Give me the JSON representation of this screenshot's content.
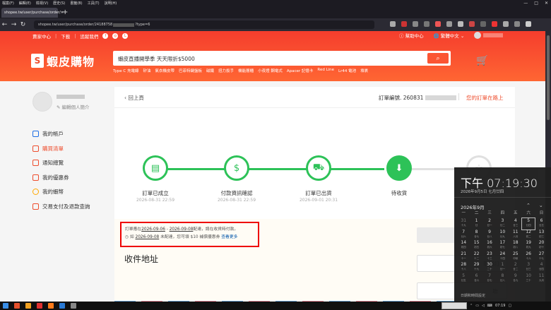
{
  "browser": {
    "menu": [
      "檔案(F)",
      "編輯(E)",
      "檢視(V)",
      "歷史(S)",
      "書籤(B)",
      "工具(T)",
      "說明(H)"
    ],
    "tab_title": "shopee.tw/user/purchase/order/",
    "url_prefix": "shopee.tw/user/purchase/order/24188758",
    "url_suffix": "?type=6"
  },
  "header": {
    "topnav": [
      "賣家中心",
      "下載",
      "追蹤我們"
    ],
    "help": "幫助中心",
    "language": "繁體中文",
    "brand_name": "蝦皮購物",
    "search_placeholder": "蝦皮直播開學季 天天限折$5000",
    "hot_keywords": [
      "Type C 充電線",
      "矽油",
      "氣衣機皮帶",
      "巴菲特鍵盤板",
      "磁鐵",
      "扭力扳手",
      "機能層櫃",
      "小夜燈 鋼電式",
      "Apacer 記憶卡",
      "Red Line",
      "Lr44 電池",
      "墳裹"
    ]
  },
  "sidebar": {
    "edit_profile": "編輯個人簡介",
    "items": [
      {
        "label": "我的帳戶",
        "color": "#1d6ee5"
      },
      {
        "label": "購買清單",
        "color": "#ee4d2d"
      },
      {
        "label": "通知總覽",
        "color": "#ee4d2d"
      },
      {
        "label": "我的優惠券",
        "color": "#ee4d2d"
      },
      {
        "label": "我的蝦幣",
        "color": "#ffa800"
      },
      {
        "label": "交易支付及退款查詢",
        "color": "#ee4d2d"
      }
    ]
  },
  "order": {
    "back_label": "回上頁",
    "order_no_label": "訂單編號. 260831",
    "status_label": "您的訂單在路上",
    "steps": [
      {
        "label": "訂單已成立",
        "time": "2026-08-31 22:59"
      },
      {
        "label": "付款資訊確認",
        "time": "2026-08-31 22:59"
      },
      {
        "label": "訂單已出貨",
        "time": "2026-09-01 20:31"
      },
      {
        "label": "待收貨",
        "time": ""
      },
      {
        "label": "待評價",
        "time": ""
      }
    ],
    "notice": {
      "line1_prefix": "訂單應在",
      "date_from": "2026-09-06",
      "sep": " - ",
      "date_to": "2026-09-08",
      "line1_suffix": "配達，請在收貨時付款。",
      "line2_prefix": "如 ",
      "line2_date": "2026-09-08",
      "line2_text": " 未配達，您可領 $10 補償優惠券",
      "more_link": "查看更多"
    },
    "cancel_button": "取消訂",
    "third_button": "聯",
    "address_title": "收件地址"
  },
  "calendar": {
    "time": "下午 07:19:30",
    "date_line": "2026年9月5日 七月廿四",
    "month": "2026年9月",
    "weekdays": [
      "一",
      "二",
      "三",
      "四",
      "五",
      "六",
      "日"
    ],
    "rows": [
      [
        [
          "31",
          "十九",
          1
        ],
        [
          "1",
          "廿",
          0
        ],
        [
          "2",
          "廿一",
          0
        ],
        [
          "3",
          "廿二",
          0
        ],
        [
          "4",
          "廿三",
          0
        ],
        [
          "5",
          "廿四",
          0
        ],
        [
          "6",
          "廿五",
          0
        ]
      ],
      [
        [
          "7",
          "廿六",
          0
        ],
        [
          "8",
          "廿七",
          0
        ],
        [
          "9",
          "廿八",
          0
        ],
        [
          "10",
          "廿九",
          0
        ],
        [
          "11",
          "八月",
          0
        ],
        [
          "12",
          "初二",
          0
        ],
        [
          "13",
          "初三",
          0
        ]
      ],
      [
        [
          "14",
          "初四",
          0
        ],
        [
          "15",
          "初五",
          0
        ],
        [
          "16",
          "初六",
          0
        ],
        [
          "17",
          "初七",
          0
        ],
        [
          "18",
          "初八",
          0
        ],
        [
          "19",
          "初九",
          0
        ],
        [
          "20",
          "初十",
          0
        ]
      ],
      [
        [
          "21",
          "十一",
          0
        ],
        [
          "22",
          "十二",
          0
        ],
        [
          "23",
          "十三",
          0
        ],
        [
          "24",
          "十四",
          0
        ],
        [
          "25",
          "中秋",
          0
        ],
        [
          "26",
          "十六",
          0
        ],
        [
          "27",
          "十七",
          0
        ]
      ],
      [
        [
          "28",
          "十八",
          0
        ],
        [
          "29",
          "十九",
          0
        ],
        [
          "30",
          "二十",
          0
        ],
        [
          "1",
          "廿一",
          1
        ],
        [
          "2",
          "廿二",
          1
        ],
        [
          "3",
          "廿三",
          1
        ],
        [
          "4",
          "廿四",
          1
        ]
      ],
      [
        [
          "5",
          "廿五",
          1
        ],
        [
          "6",
          "廿六",
          1
        ],
        [
          "7",
          "廿七",
          1
        ],
        [
          "8",
          "廿八",
          1
        ],
        [
          "9",
          "廿九",
          1
        ],
        [
          "10",
          "三十",
          1
        ],
        [
          "11",
          "九月",
          1
        ]
      ]
    ],
    "today_index": [
      0,
      5
    ],
    "footer": "日期和時間設定"
  },
  "taskbar": {
    "time": "07:19"
  },
  "colors": {
    "brand": "#ee4d2d",
    "step_done": "#2dc258",
    "link": "#0055aa"
  }
}
